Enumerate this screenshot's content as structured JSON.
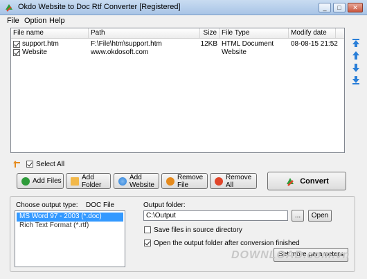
{
  "window": {
    "title": "Okdo Website to Doc Rtf Converter [Registered]",
    "minimize": "_",
    "maximize": "□",
    "close": "✕"
  },
  "menu": [
    "File",
    "Option",
    "Help"
  ],
  "files": {
    "headers": [
      "File name",
      "Path",
      "Size",
      "File Type",
      "Modify date"
    ],
    "rows": [
      {
        "checked": true,
        "name": "support.htm",
        "path": "F:\\File\\htm\\support.htm",
        "size": "12KB",
        "type": "HTML Document",
        "date": "08-08-15 21:52"
      },
      {
        "checked": true,
        "name": "Website",
        "path": "www.okdosoft.com",
        "size": "",
        "type": "Website",
        "date": ""
      }
    ]
  },
  "select_all": "Select All",
  "buttons": {
    "add_files": "Add Files",
    "add_folder": "Add Folder",
    "add_website": "Add Website",
    "remove_file": "Remove File",
    "remove_all": "Remove All",
    "convert": "Convert"
  },
  "output": {
    "type_label": "Choose output type:",
    "type_value": "DOC File",
    "types": [
      "MS Word 97 - 2003 (*.doc)",
      "Rich Text Format (*.rtf)"
    ],
    "folder_label": "Output folder:",
    "folder_value": "C:\\Output",
    "browse": "...",
    "open": "Open",
    "save_in_source": "Save files in source directory",
    "open_after": "Open the output folder after conversion finished",
    "set_more": "Set more parameters"
  },
  "watermark": "DOWNLOAD.com.vn",
  "colors": {
    "selection": "#3399ff",
    "accent_green": "#2e9b3a",
    "accent_red": "#e0452a",
    "accent_blue": "#2a7fd8"
  }
}
